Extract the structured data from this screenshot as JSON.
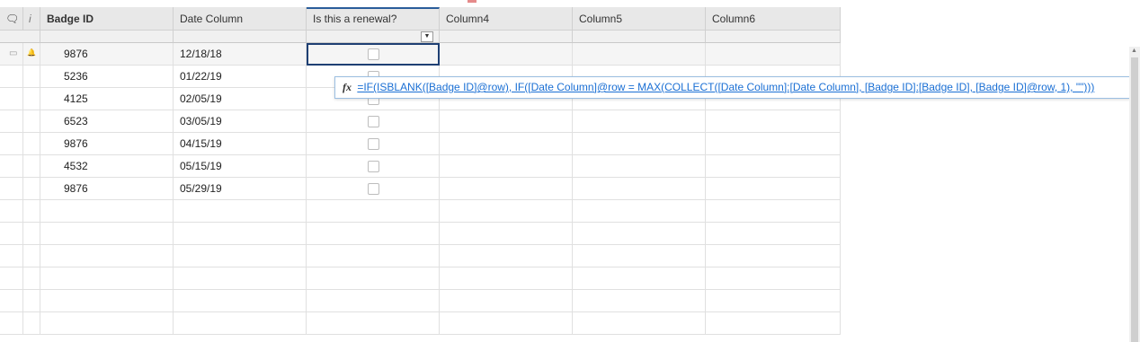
{
  "accent_color": "#2a5d9a",
  "header": {
    "comment_icon": "comment-icon",
    "info_label": "i",
    "badge_id": "Badge ID",
    "date_column": "Date Column",
    "renewal": "Is this a renewal?",
    "column4": "Column4",
    "column5": "Column5",
    "column6": "Column6"
  },
  "rows": [
    {
      "badge_id": "9876",
      "date": "12/18/18",
      "renewal": false
    },
    {
      "badge_id": "5236",
      "date": "01/22/19",
      "renewal": false
    },
    {
      "badge_id": "4125",
      "date": "02/05/19",
      "renewal": false
    },
    {
      "badge_id": "6523",
      "date": "03/05/19",
      "renewal": false
    },
    {
      "badge_id": "9876",
      "date": "04/15/19",
      "renewal": false
    },
    {
      "badge_id": "4532",
      "date": "05/15/19",
      "renewal": false
    },
    {
      "badge_id": "9876",
      "date": "05/29/19",
      "renewal": false
    }
  ],
  "formula": {
    "icon": "fx-icon",
    "fx_label": "fx",
    "text": "=IF(ISBLANK([Badge ID]@row), IF([Date Column]@row = MAX(COLLECT([Date Column]:[Date Column], [Badge ID]:[Badge ID], [Badge ID]@row, 1), \"\")))"
  }
}
